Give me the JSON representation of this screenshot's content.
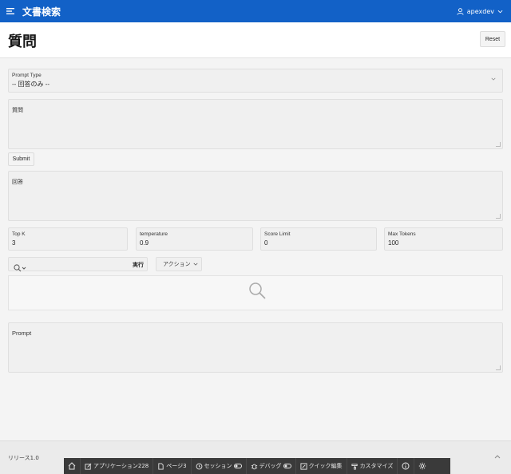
{
  "header": {
    "app_title": "文書検索",
    "user_name": "apexdev",
    "icons": {
      "menu": "hamburger-icon",
      "user": "user-icon",
      "dropdown": "chevron-down-icon"
    }
  },
  "page": {
    "title": "質問",
    "reset_label": "Reset"
  },
  "form": {
    "prompt_type": {
      "label": "Prompt Type",
      "value": "-- 回答のみ --"
    },
    "question": {
      "label": "質問",
      "value": ""
    },
    "submit_label": "Submit",
    "answer": {
      "label": "回答",
      "value": ""
    },
    "top_k": {
      "label": "Top K",
      "value": "3"
    },
    "temperature": {
      "label": "temperature",
      "value": "0.9"
    },
    "score_limit": {
      "label": "Score Limit",
      "value": "0"
    },
    "max_tokens": {
      "label": "Max Tokens",
      "value": "100"
    },
    "prompt": {
      "label": "Prompt",
      "value": ""
    }
  },
  "report": {
    "search_value": "",
    "go_label": "実行",
    "actions_label": "アクション"
  },
  "footer": {
    "release": "リリース1.0"
  },
  "devbar": {
    "items": [
      {
        "label": "",
        "icon": "home-icon"
      },
      {
        "label": "アプリケーション228",
        "icon": "edit-app-icon"
      },
      {
        "label": "ページ3",
        "icon": "edit-page-icon"
      },
      {
        "label": "セッション",
        "icon": "session-icon"
      },
      {
        "label": "デバッグ",
        "icon": "debug-icon"
      },
      {
        "label": "クイック編集",
        "icon": "quick-edit-icon"
      },
      {
        "label": "カスタマイズ",
        "icon": "customize-icon"
      },
      {
        "label": "",
        "icon": "info-icon"
      },
      {
        "label": "",
        "icon": "settings-icon"
      }
    ]
  },
  "colors": {
    "header_bg": "#1261c7",
    "devbar_bg": "#3a3a3a"
  }
}
